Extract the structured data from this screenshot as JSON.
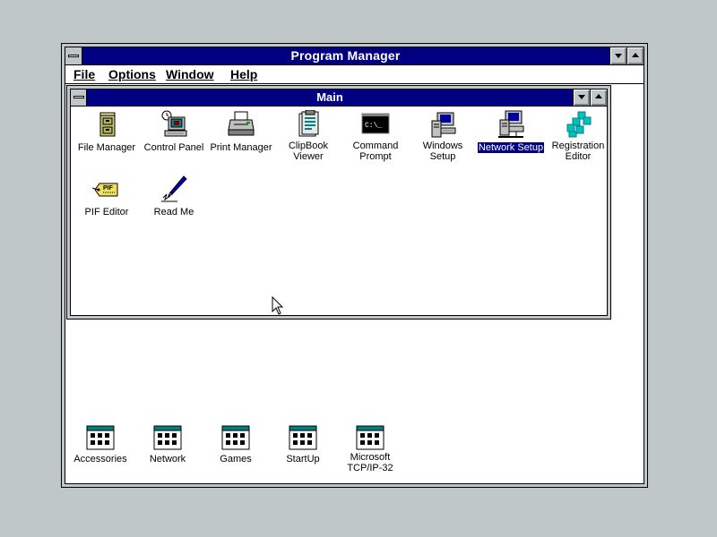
{
  "window": {
    "title": "Program Manager"
  },
  "menu": {
    "items": [
      "File",
      "Options",
      "Window",
      "Help"
    ]
  },
  "main_group": {
    "title": "Main",
    "icons": [
      {
        "label": "File Manager",
        "icon": "file-cabinet-icon",
        "selected": false
      },
      {
        "label": "Control Panel",
        "icon": "control-panel-icon",
        "selected": false
      },
      {
        "label": "Print Manager",
        "icon": "printer-icon",
        "selected": false
      },
      {
        "label": "ClipBook\nViewer",
        "icon": "clipbook-icon",
        "selected": false
      },
      {
        "label": "Command\nPrompt",
        "icon": "command-prompt-icon",
        "selected": false
      },
      {
        "label": "Windows\nSetup",
        "icon": "windows-setup-icon",
        "selected": false
      },
      {
        "label": "Network Setup",
        "icon": "network-setup-icon",
        "selected": true
      },
      {
        "label": "Registration\nEditor",
        "icon": "registry-cubes-icon",
        "selected": false
      },
      {
        "label": "PIF Editor",
        "icon": "pif-tag-icon",
        "selected": false
      },
      {
        "label": "Read Me",
        "icon": "pen-note-icon",
        "selected": false
      }
    ]
  },
  "groups": [
    {
      "label": "Accessories"
    },
    {
      "label": "Network"
    },
    {
      "label": "Games"
    },
    {
      "label": "StartUp"
    },
    {
      "label": "Microsoft\nTCP/IP-32"
    }
  ],
  "colors": {
    "titlebar": "#000080",
    "desktop": "#c0c7c8",
    "selection": "#000080"
  }
}
